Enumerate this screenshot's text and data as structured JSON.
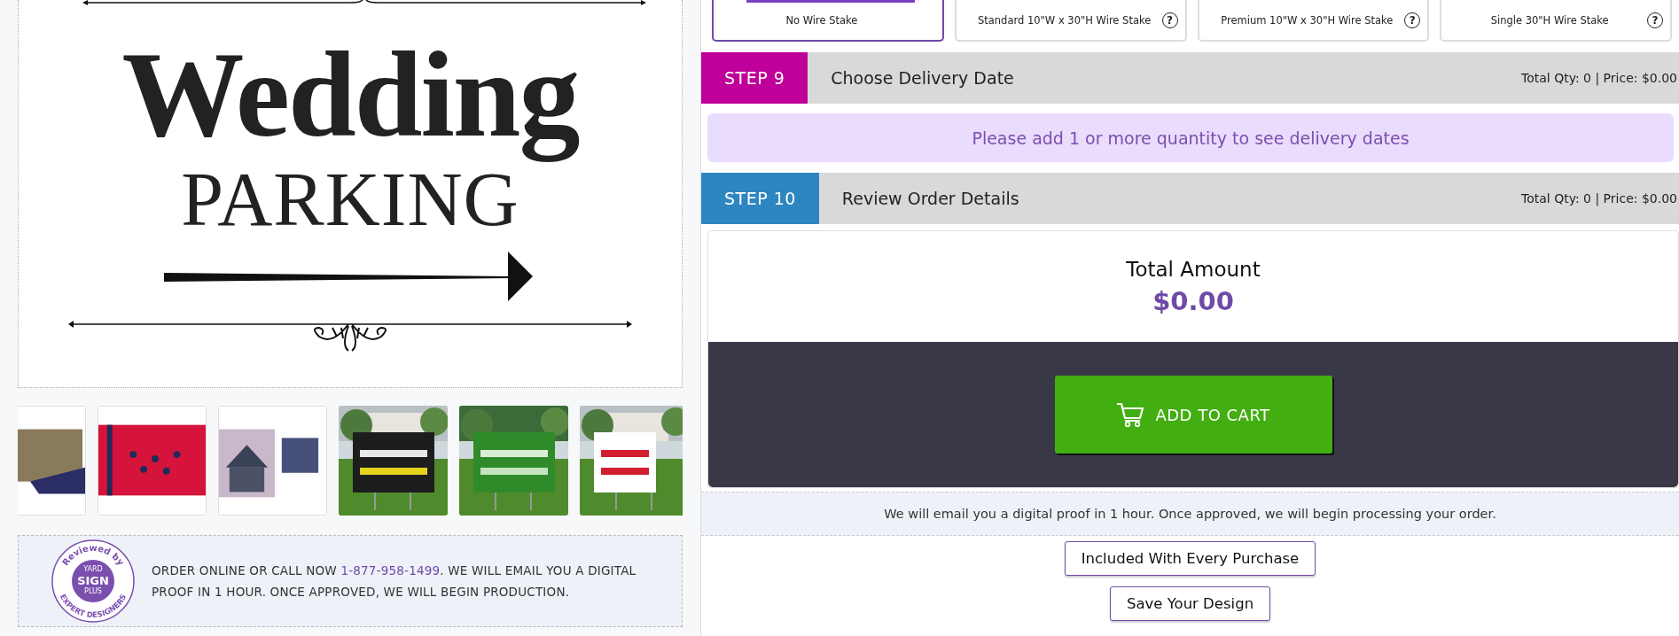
{
  "sign_preview": {
    "title": "Wedding",
    "subtitle": "PARKING"
  },
  "info_box": {
    "badge": {
      "top": "Reviewed by",
      "brand_top": "YARD",
      "brand": "SIGN",
      "brand_bottom": "PLUS",
      "bottom": "EXPERT DESIGNERS"
    },
    "text_before": "ORDER ONLINE OR CALL NOW ",
    "phone": "1-877-958-1499",
    "text_after": ". WE WILL EMAIL YOU A DIGITAL PROOF IN 1 HOUR. ONCE APPROVED, WE WILL BEGIN PRODUCTION."
  },
  "stake_options": [
    {
      "label": "No Wire Stake",
      "selected": true
    },
    {
      "label": "Standard 10\"W x 30\"H Wire Stake",
      "selected": false,
      "help": "?"
    },
    {
      "label": "Premium 10\"W x 30\"H Wire Stake",
      "selected": false,
      "help": "?"
    },
    {
      "label": "Single 30\"H Wire Stake",
      "selected": false,
      "help": "?"
    }
  ],
  "steps": [
    {
      "step": "STEP 9",
      "title": "Choose Delivery Date",
      "summary": "Total Qty: 0 | Price: $0.00",
      "color": "#c0009a"
    },
    {
      "step": "STEP 10",
      "title": "Review Order Details",
      "summary": "Total Qty: 0 | Price: $0.00",
      "color": "#2e86c1"
    }
  ],
  "delivery_notice": "Please add 1 or more quantity to see delivery dates",
  "order_total": {
    "label": "Total Amount",
    "amount": "$0.00"
  },
  "add_to_cart": "ADD TO CART",
  "proof_notice": "We will email you a digital proof in 1 hour. Once approved, we will begin processing your order.",
  "buttons": [
    "Included With Every Purchase",
    "Save Your Design"
  ]
}
